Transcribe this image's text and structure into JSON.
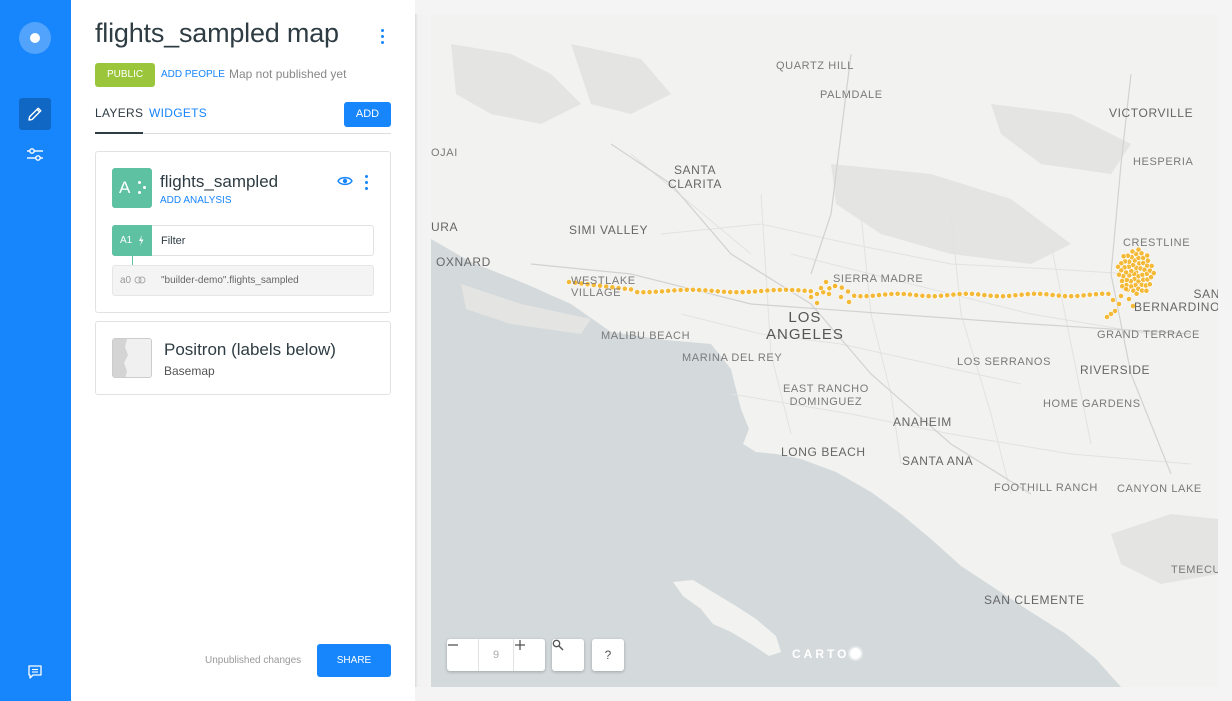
{
  "rail": {
    "logo_icon": "carto-logo-icon",
    "items": [
      {
        "icon": "pencil-icon",
        "active": true
      },
      {
        "icon": "sliders-icon",
        "active": false
      }
    ],
    "footer_icon": "chat-icon"
  },
  "header": {
    "title": "flights_sampled map",
    "privacy": "PUBLIC",
    "add_people": "ADD PEOPLE",
    "publish_status": "Map not published yet"
  },
  "tabs": {
    "layers": "LAYERS",
    "widgets": "WIDGETS",
    "add": "ADD"
  },
  "layer": {
    "letter": "A",
    "name": "flights_sampled",
    "add_analysis": "ADD ANALYSIS",
    "analysis": {
      "id": "A1",
      "label": "Filter"
    },
    "source": {
      "id": "a0",
      "label": "\"builder-demo\".flights_sampled"
    },
    "color": "#5dc1a2"
  },
  "basemap": {
    "name": "Positron (labels below)",
    "type": "Basemap"
  },
  "footer": {
    "unpublished": "Unpublished changes",
    "share": "SHARE"
  },
  "map": {
    "zoom_level": "9",
    "help": "?",
    "attribution": "CARTO",
    "point_color": "#f5b324",
    "labels": {
      "quartz_hill": "QUARTZ HILL",
      "palmdale": "PALMDALE",
      "victorville": "VICTORVILLE",
      "hesperia": "HESPERIA",
      "ojai": "OJAI",
      "santa_clarita": "SANTA\nCLARITA",
      "simi_valley": "SIMI VALLEY",
      "crestline": "CRESTLINE",
      "oxnard": "OXNARD",
      "ura": "URA",
      "westlake_village": "WESTLAKE\nVILLAGE",
      "sierra_madre": "SIERRA MADRE",
      "san_bernardino": "SAN\nBERNARDINO",
      "los_angeles": "LOS\nANGELES",
      "malibu_beach": "MALIBU BEACH",
      "grand_terrace": "GRAND TERRACE",
      "marina_del_rey": "MARINA DEL REY",
      "los_serranos": "LOS SERRANOS",
      "riverside": "RIVERSIDE",
      "east_rancho_dominguez": "EAST RANCHO\nDOMINGUEZ",
      "home_gardens": "HOME GARDENS",
      "anaheim": "ANAHEIM",
      "long_beach": "LONG BEACH",
      "santa_ana": "SANTA ANA",
      "foothill_ranch": "FOOTHILL RANCH",
      "canyon_lake": "CANYON LAKE",
      "temecula": "TEMECU",
      "san_clemente": "SAN CLEMENTE"
    }
  }
}
